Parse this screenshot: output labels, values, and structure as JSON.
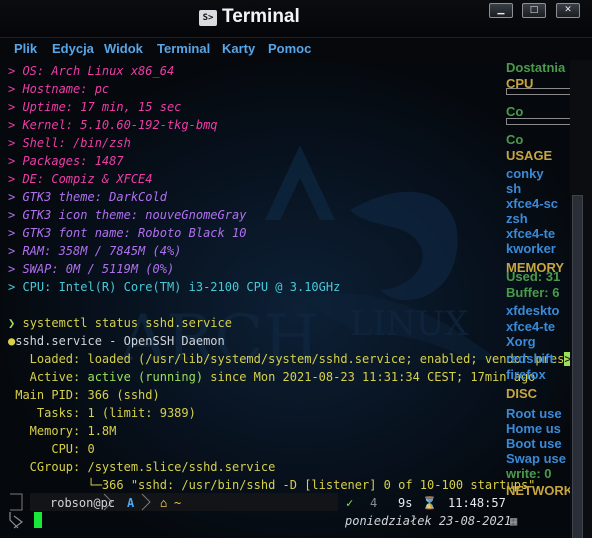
{
  "window": {
    "title": "Terminal",
    "icon": "terminal-icon",
    "icon_glyph": "S>",
    "controls": [
      "minimize-icon",
      "maximize-icon",
      "close-icon"
    ]
  },
  "menu": [
    "Plik",
    "Edycja",
    "Widok",
    "Terminal",
    "Karty",
    "Pomoc"
  ],
  "sysinfo": [
    "> OS: Arch Linux x86_64",
    "> Hostname: pc",
    "> Uptime: 17 min, 15 sec",
    "> Kernel: 5.10.60-192-tkg-bmq",
    "> Shell: /bin/zsh",
    "> Packages: 1487",
    "> DE: Compiz & XFCE4",
    "> GTK3 theme: DarkCold",
    "> GTK3 icon theme: nouveGnomeGray",
    "> GTK3 font name: Roboto Black 10",
    "> RAM: 358M / 7845M (4%)",
    "> SWAP: 0M / 5119M (0%)",
    "> CPU: Intel(R) Core(TM) i3-2100 CPU @ 3.10GHz"
  ],
  "command": {
    "prompt": "❯",
    "text": "systemctl status sshd.service"
  },
  "service": {
    "bullet": "●",
    "header": "sshd.service - OpenSSH Daemon",
    "loaded_label": "   Loaded:",
    "loaded_value": " loaded (/usr/lib/systemd/system/sshd.service; enabled; vendor pres",
    "overflow_marker": ">",
    "active_label": "   Active:",
    "active_state": " active (running)",
    "active_since": " since Mon 2021-08-23 11:31:34 CEST; 17min ago",
    "mainpid_label": " Main PID:",
    "mainpid_value": " 366 (sshd)",
    "tasks_label": "    Tasks:",
    "tasks_value": " 1 (limit: 9389)",
    "memory_label": "   Memory:",
    "memory_value": " 1.8M",
    "cpu_label": "      CPU:",
    "cpu_value": " 0",
    "cgroup_label": "   CGroup:",
    "cgroup_value": " /system.slice/sshd.service",
    "cgroup_child": "           └─366 \"sshd: /usr/bin/sshd -D [listener] 0 of 10-100 startups\""
  },
  "prompt_bar": {
    "user": "robson@pc",
    "arch_glyph": "A",
    "home_glyph": "~",
    "check": "✓",
    "jobs": "4",
    "duration": "9s",
    "hourglass": "⌛",
    "time": "11:48:57",
    "date": "poniedziałek 23-08-2021",
    "input_prompt": ">",
    "status_color": "#9be05a"
  },
  "conky": {
    "lines": [
      {
        "text": "Dostatnia",
        "kind": "green"
      },
      {
        "text": "CPU",
        "kind": "header"
      },
      {
        "text": "Co",
        "kind": "green"
      },
      {
        "text": "Co",
        "kind": "green"
      },
      {
        "text": "USAGE",
        "kind": "header"
      },
      {
        "text": "conky",
        "kind": "blue"
      },
      {
        "text": "sh",
        "kind": "blue"
      },
      {
        "text": "xfce4-sc",
        "kind": "blue"
      },
      {
        "text": "zsh",
        "kind": "blue"
      },
      {
        "text": "xfce4-te",
        "kind": "blue"
      },
      {
        "text": "kworker",
        "kind": "blue"
      },
      {
        "text": "MEMORY",
        "kind": "header"
      },
      {
        "text": "Used: 31",
        "kind": "green"
      },
      {
        "text": "Buffer: 6",
        "kind": "green"
      },
      {
        "text": "xfdeskto",
        "kind": "blue"
      },
      {
        "text": "xfce4-te",
        "kind": "blue"
      },
      {
        "text": "Xorg",
        "kind": "blue"
      },
      {
        "text": "redshift",
        "kind": "blue"
      },
      {
        "text": "firefox",
        "kind": "blue"
      },
      {
        "text": "DISC",
        "kind": "header"
      },
      {
        "text": "Root use",
        "kind": "blue"
      },
      {
        "text": "Home us",
        "kind": "blue"
      },
      {
        "text": "Boot use",
        "kind": "blue"
      },
      {
        "text": "Swap use",
        "kind": "blue"
      },
      {
        "text": "write: 0",
        "kind": "green"
      },
      {
        "text": "NETWORK",
        "kind": "header"
      }
    ]
  },
  "colors": {
    "info": "#ee3ca7",
    "info_highlight": "#b070f0",
    "accent": "#48c9d6",
    "value": "#d7d04a",
    "menu": "#56a6e8"
  }
}
